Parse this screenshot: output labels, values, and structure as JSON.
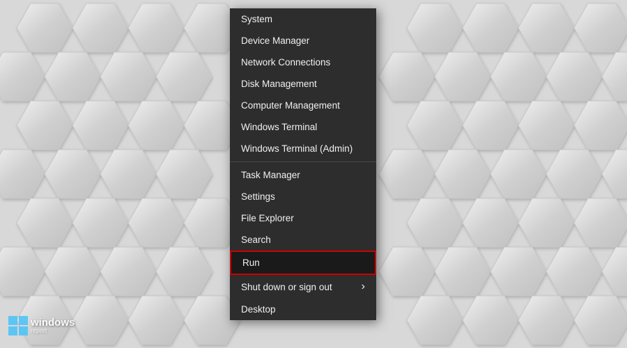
{
  "background": {
    "color": "#d5d5d5"
  },
  "menu": {
    "items": [
      {
        "id": "system",
        "label": "System",
        "divider_after": false,
        "highlighted": false,
        "has_submenu": false
      },
      {
        "id": "device-manager",
        "label": "Device Manager",
        "divider_after": false,
        "highlighted": false,
        "has_submenu": false
      },
      {
        "id": "network-connections",
        "label": "Network Connections",
        "divider_after": false,
        "highlighted": false,
        "has_submenu": false
      },
      {
        "id": "disk-management",
        "label": "Disk Management",
        "divider_after": false,
        "highlighted": false,
        "has_submenu": false
      },
      {
        "id": "computer-management",
        "label": "Computer Management",
        "divider_after": false,
        "highlighted": false,
        "has_submenu": false
      },
      {
        "id": "windows-terminal",
        "label": "Windows Terminal",
        "divider_after": false,
        "highlighted": false,
        "has_submenu": false
      },
      {
        "id": "windows-terminal-admin",
        "label": "Windows Terminal (Admin)",
        "divider_after": true,
        "highlighted": false,
        "has_submenu": false
      },
      {
        "id": "task-manager",
        "label": "Task Manager",
        "divider_after": false,
        "highlighted": false,
        "has_submenu": false
      },
      {
        "id": "settings",
        "label": "Settings",
        "divider_after": false,
        "highlighted": false,
        "has_submenu": false
      },
      {
        "id": "file-explorer",
        "label": "File Explorer",
        "divider_after": false,
        "highlighted": false,
        "has_submenu": false
      },
      {
        "id": "search",
        "label": "Search",
        "divider_after": false,
        "highlighted": false,
        "has_submenu": false
      },
      {
        "id": "run",
        "label": "Run",
        "divider_after": false,
        "highlighted": true,
        "has_submenu": false
      },
      {
        "id": "shut-down",
        "label": "Shut down or sign out",
        "divider_after": false,
        "highlighted": false,
        "has_submenu": true
      },
      {
        "id": "desktop",
        "label": "Desktop",
        "divider_after": false,
        "highlighted": false,
        "has_submenu": false
      }
    ]
  },
  "brand": {
    "name": "windows",
    "subtext": "report"
  }
}
